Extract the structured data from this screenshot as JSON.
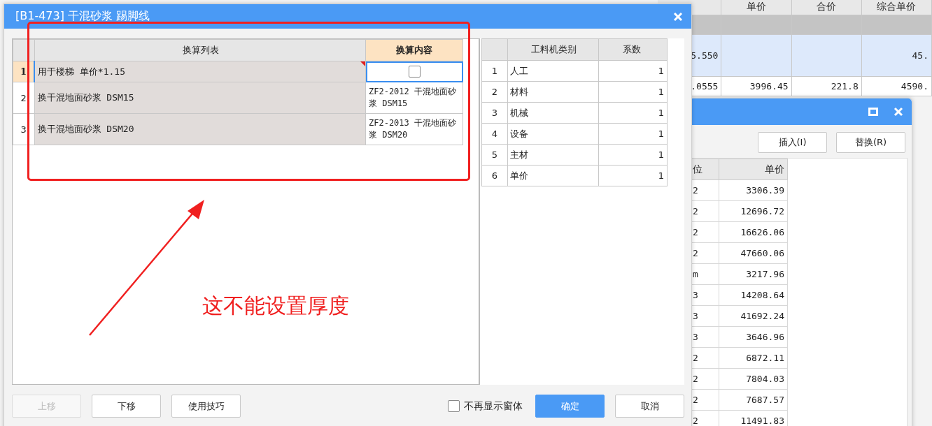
{
  "background_table": {
    "columns": [
      "",
      "单价",
      "合价",
      "综合单价"
    ],
    "rows": [
      {
        "kind": "group",
        "cells": [
          "",
          "",
          "",
          ""
        ]
      },
      {
        "kind": "selected",
        "cells": [
          "5.550",
          "",
          "",
          "45."
        ]
      },
      {
        "kind": "plain",
        "cells": [
          ".0555",
          "3996.45",
          "221.8",
          "4590."
        ]
      }
    ]
  },
  "secondary_dialog": {
    "buttons": [
      "插入(I)",
      "替换(R)"
    ],
    "table": {
      "columns": [
        "位",
        "单价"
      ],
      "rows": [
        [
          "2",
          "3306.39"
        ],
        [
          "2",
          "12696.72"
        ],
        [
          "2",
          "16626.06"
        ],
        [
          "2",
          "47660.06"
        ],
        [
          "m",
          "3217.96"
        ],
        [
          "3",
          "14208.64"
        ],
        [
          "3",
          "41692.24"
        ],
        [
          "3",
          "3646.96"
        ],
        [
          "2",
          "6872.11"
        ],
        [
          "2",
          "7804.03"
        ],
        [
          "2",
          "7687.57"
        ],
        [
          "2",
          "11491.83"
        ]
      ]
    }
  },
  "main_dialog": {
    "title": "[B1-473] 干混砂浆 踢脚线",
    "conversion_table": {
      "columns": [
        "",
        "换算列表",
        "换算内容"
      ],
      "rows": [
        {
          "index": "1",
          "selected": true,
          "name": "用于楼梯 单价*1.15",
          "kind": "checkbox",
          "checked": false
        },
        {
          "index": "2",
          "selected": false,
          "name": "换干混地面砂浆 DSM15",
          "kind": "text",
          "content": "ZF2-2012  干混地面砂浆 DSM15"
        },
        {
          "index": "3",
          "selected": false,
          "name": "换干混地面砂浆 DSM20",
          "kind": "text",
          "content": "ZF2-2013  干混地面砂浆 DSM20"
        }
      ]
    },
    "coefficient_table": {
      "columns": [
        "",
        "工料机类别",
        "系数"
      ],
      "rows": [
        [
          "1",
          "人工",
          "1"
        ],
        [
          "2",
          "材料",
          "1"
        ],
        [
          "3",
          "机械",
          "1"
        ],
        [
          "4",
          "设备",
          "1"
        ],
        [
          "5",
          "主材",
          "1"
        ],
        [
          "6",
          "单价",
          "1"
        ]
      ]
    },
    "left_buttons": [
      {
        "label": "上移",
        "disabled": true
      },
      {
        "label": "下移",
        "disabled": false
      },
      {
        "label": "使用技巧",
        "disabled": false
      }
    ],
    "dont_show_again": {
      "label": "不再显示窗体",
      "checked": false
    },
    "right_buttons": [
      {
        "label": "确定",
        "kind": "primary"
      },
      {
        "label": "取消",
        "kind": "normal"
      }
    ]
  },
  "annotation": {
    "text": "这不能设置厚度"
  }
}
